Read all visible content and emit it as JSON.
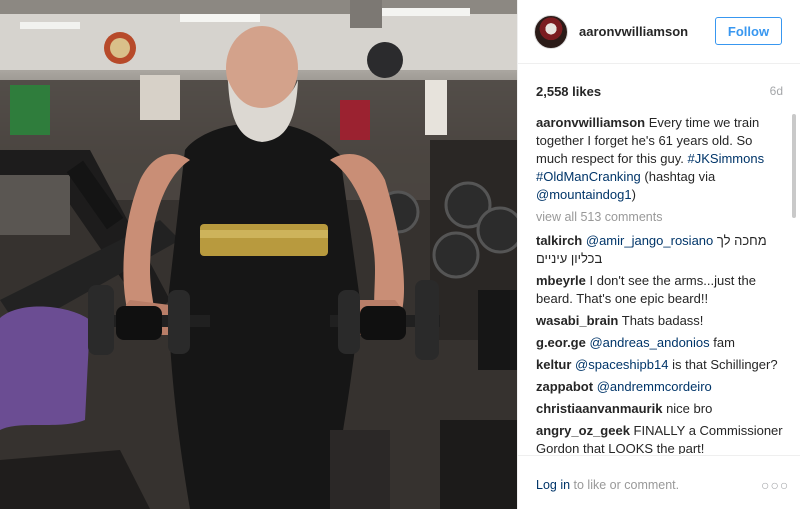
{
  "post": {
    "username": "aaronvwilliamson",
    "follow_label": "Follow",
    "likes": "2,558 likes",
    "time": "6d"
  },
  "caption": {
    "user": "aaronvwilliamson",
    "text1": " Every time we train together I forget he's 61 years old. So much respect for this guy. ",
    "tag1": "#JKSimmons",
    "tag2": "#OldManCranking",
    "text2": " (hashtag via ",
    "mention": "@mountaindog1",
    "text3": ")"
  },
  "view_all": "view all 513 comments",
  "comments": [
    {
      "user": "talkirch",
      "parts": [
        {
          "t": " "
        },
        {
          "t": "@amir_jango_rosiano",
          "link": true
        },
        {
          "t": " מחכה לך בכליון עיניים"
        }
      ]
    },
    {
      "user": "mbeyrle",
      "parts": [
        {
          "t": " I don't see the arms...just the beard. That's one epic beard!!"
        }
      ]
    },
    {
      "user": "wasabi_brain",
      "parts": [
        {
          "t": " Thats badass!"
        }
      ]
    },
    {
      "user": "g.eor.ge",
      "parts": [
        {
          "t": " "
        },
        {
          "t": "@andreas_andonios",
          "link": true
        },
        {
          "t": " fam"
        }
      ]
    },
    {
      "user": "keltur",
      "parts": [
        {
          "t": " "
        },
        {
          "t": "@spaceshipb14",
          "link": true
        },
        {
          "t": " is that Schillinger?"
        }
      ]
    },
    {
      "user": "zappabot",
      "parts": [
        {
          "t": " "
        },
        {
          "t": "@andremmcordeiro",
          "link": true
        }
      ]
    },
    {
      "user": "christiaanvanmaurik",
      "parts": [
        {
          "t": " nice bro"
        }
      ]
    },
    {
      "user": "angry_oz_geek",
      "parts": [
        {
          "t": " FINALLY a Commissioner Gordon that LOOKS the part!"
        }
      ]
    }
  ],
  "footer": {
    "login_link": "Log in",
    "login_rest": " to like or comment.",
    "more": "○○○"
  },
  "colors": {
    "link": "#003569",
    "follow": "#3897f0",
    "muted": "#999999"
  },
  "icons": {
    "more": "more-options-icon"
  }
}
